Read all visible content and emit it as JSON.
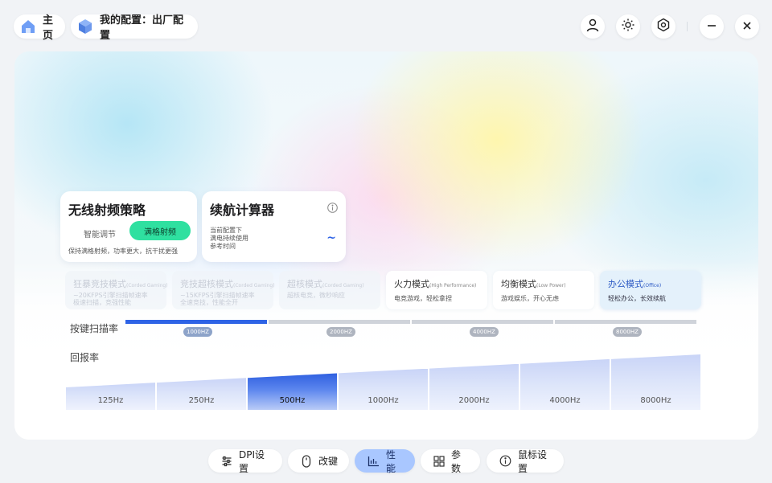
{
  "topbar": {
    "home_label": "主页",
    "config_label": "我的配置：出厂配置"
  },
  "rf_card": {
    "title": "无线射频策略",
    "option_smart": "智能调节",
    "option_full": "满格射频",
    "description": "保持满格射频，功率更大，抗干扰更强"
  },
  "battery_card": {
    "title": "续航计算器",
    "line1": "当前配置下",
    "line2": "满电持续使用",
    "line3": "参考时间",
    "value": "~"
  },
  "modes": [
    {
      "title": "狂暴竞技模式",
      "subtitle": "(Corded Gaming)",
      "desc1": "~20KFPS引擎扫描帧速率",
      "desc2": "极速扫描，竞强性能",
      "state": "disabled"
    },
    {
      "title": "竞技超核模式",
      "subtitle": "(Corded Gaming)",
      "desc1": "~15KFPS引擎扫描帧速率",
      "desc2": "全速竞技，性能全开",
      "state": "disabled"
    },
    {
      "title": "超核模式",
      "subtitle": "(Corded Gaming)",
      "desc1": "超核电竞，微秒响应",
      "desc2": "",
      "state": "disabled"
    },
    {
      "title": "火力模式",
      "subtitle": "(High Performance)",
      "desc1": "电竞游戏，轻松拿捏",
      "desc2": "",
      "state": "normal"
    },
    {
      "title": "均衡模式",
      "subtitle": "(Low Power)",
      "desc1": "游戏娱乐，开心无虑",
      "desc2": "",
      "state": "normal"
    },
    {
      "title": "办公模式",
      "subtitle": "(Office)",
      "desc1": "轻松办公，长效续航",
      "desc2": "",
      "state": "active"
    }
  ],
  "scan_rate": {
    "label": "按键扫描率",
    "options": [
      "1000HZ",
      "2000HZ",
      "4000HZ",
      "8000HZ"
    ],
    "selected_index": 0
  },
  "report_rate": {
    "label": "回报率",
    "options": [
      "125Hz",
      "250Hz",
      "500Hz",
      "1000Hz",
      "2000Hz",
      "4000Hz",
      "8000Hz"
    ],
    "selected_index": 2
  },
  "bottom_nav": [
    {
      "label": "DPI设置",
      "icon": "dpi-sliders-icon"
    },
    {
      "label": "改键",
      "icon": "mouse-icon"
    },
    {
      "label": "性能",
      "icon": "performance-chart-icon"
    },
    {
      "label": "参数",
      "icon": "grid-icon"
    },
    {
      "label": "鼠标设置",
      "icon": "info-circle-icon"
    }
  ],
  "active_nav_index": 2,
  "colors": {
    "accent_green": "#2fe0a0",
    "accent_blue": "#2e63e6",
    "active_mode_text": "#2f5cc5",
    "nav_active_bg": "#a9c7ff"
  }
}
